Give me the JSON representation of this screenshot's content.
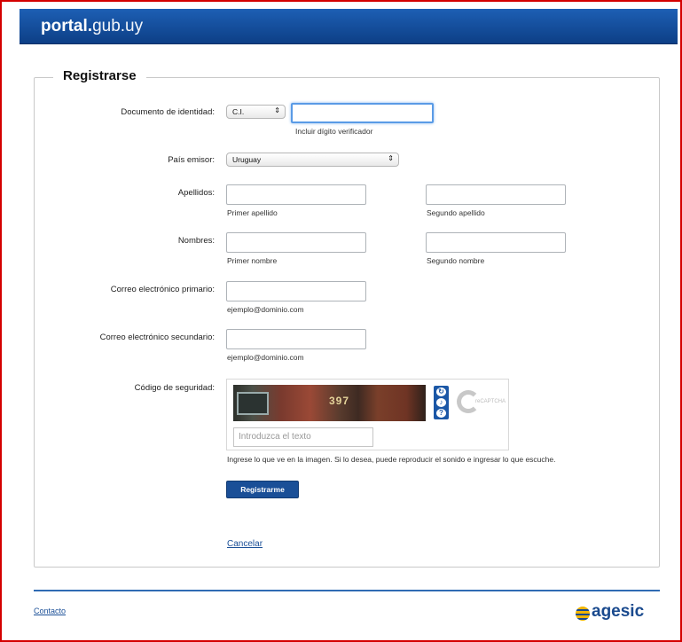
{
  "header": {
    "logo_bold": "portal.",
    "logo_rest": "gub.uy"
  },
  "form": {
    "legend": "Registrarse",
    "documento": {
      "label": "Documento de identidad:",
      "type_value": "C.I.",
      "value": "",
      "hint": "Incluir dígito verificador"
    },
    "pais": {
      "label": "País emisor:",
      "value": "Uruguay"
    },
    "apellidos": {
      "label": "Apellidos:",
      "first_hint": "Primer apellido",
      "second_hint": "Segundo apellido"
    },
    "nombres": {
      "label": "Nombres:",
      "first_hint": "Primer nombre",
      "second_hint": "Segundo nombre"
    },
    "correo_primario": {
      "label": "Correo electrónico primario:",
      "hint": "ejemplo@dominio.com"
    },
    "correo_secundario": {
      "label": "Correo electrónico secundario:",
      "hint": "ejemplo@dominio.com"
    },
    "captcha": {
      "label": "Código de seguridad:",
      "image_text": "397",
      "placeholder": "Introduzca el texto",
      "instructions": "Ingrese lo que ve en la imagen. Si lo desea, puede reproducir el sonido e ingresar lo que escuche."
    },
    "submit_label": "Registrarme",
    "cancel_label": "Cancelar"
  },
  "footer": {
    "contact_label": "Contacto",
    "brand": "agesic"
  },
  "colors": {
    "header_blue": "#0d3f86",
    "button_blue": "#1a4f97",
    "frame_red": "#d40000"
  }
}
